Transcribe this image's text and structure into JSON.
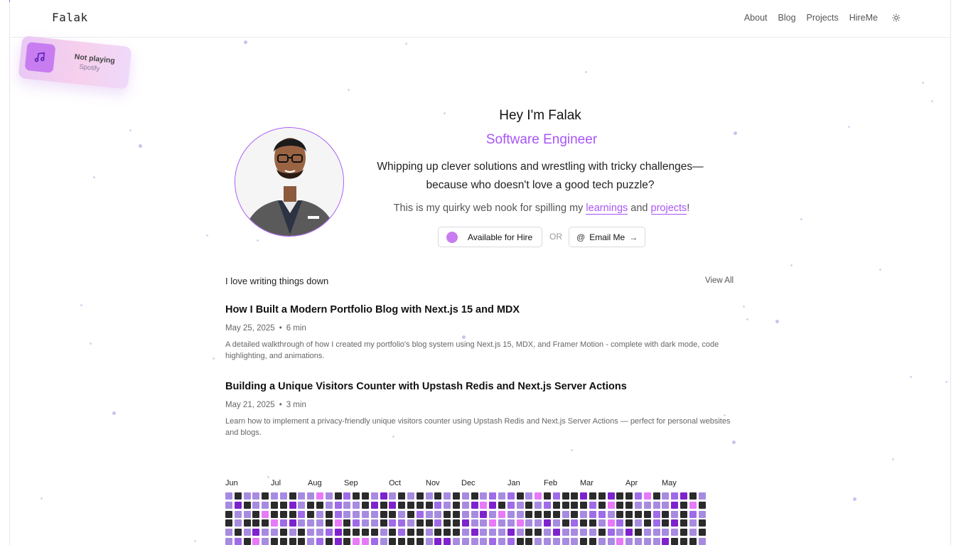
{
  "site": {
    "logo": "Falak"
  },
  "nav": {
    "items": [
      "About",
      "Blog",
      "Projects",
      "HireMe"
    ],
    "theme_icon": "sun-icon"
  },
  "spotify": {
    "status": "Not playing",
    "source": "Spotify",
    "icon": "music-note-icon"
  },
  "hero": {
    "greeting": "Hey I'm Falak",
    "role": "Software Engineer",
    "description": "Whipping up clever solutions and wrestling with tricky challenges—because who doesn't love a good tech puzzle?",
    "nook_prefix": "This is my quirky web nook for spilling my ",
    "nook_link1": "learnings",
    "nook_mid": " and ",
    "nook_link2": "projects",
    "nook_suffix": "!",
    "hire_label": "Available for Hire",
    "or_label": "OR",
    "email_label": "Email Me",
    "avatar_icon": "profile-photo"
  },
  "blog": {
    "section_title": "I love writing things down",
    "view_all": "View All",
    "posts": [
      {
        "title": "How I Built a Modern Portfolio Blog with Next.js 15 and MDX",
        "date": "May 25, 2025",
        "read_time": "6 min",
        "excerpt": "A detailed walkthrough of how I created my portfolio's blog system using Next.js 15, MDX, and Framer Motion - complete with dark mode, code highlighting, and animations."
      },
      {
        "title": "Building a Unique Visitors Counter with Upstash Redis and Next.js Server Actions",
        "date": "May 21, 2025",
        "read_time": "3 min",
        "excerpt": "Learn how to implement a privacy-friendly unique visitors counter using Upstash Redis and Next.js Server Actions — perfect for personal websites and blogs."
      }
    ]
  },
  "contributions": {
    "months": [
      "Jun",
      "Jul",
      "Aug",
      "Sep",
      "Oct",
      "Nov",
      "Dec",
      "Jan",
      "Feb",
      "Mar",
      "Apr",
      "May"
    ],
    "colors": {
      "none": "#2b2b2b",
      "low": "#a78be0",
      "mid": "#9f6be8",
      "high": "#7e22ce",
      "peak": "#e879f9"
    }
  }
}
